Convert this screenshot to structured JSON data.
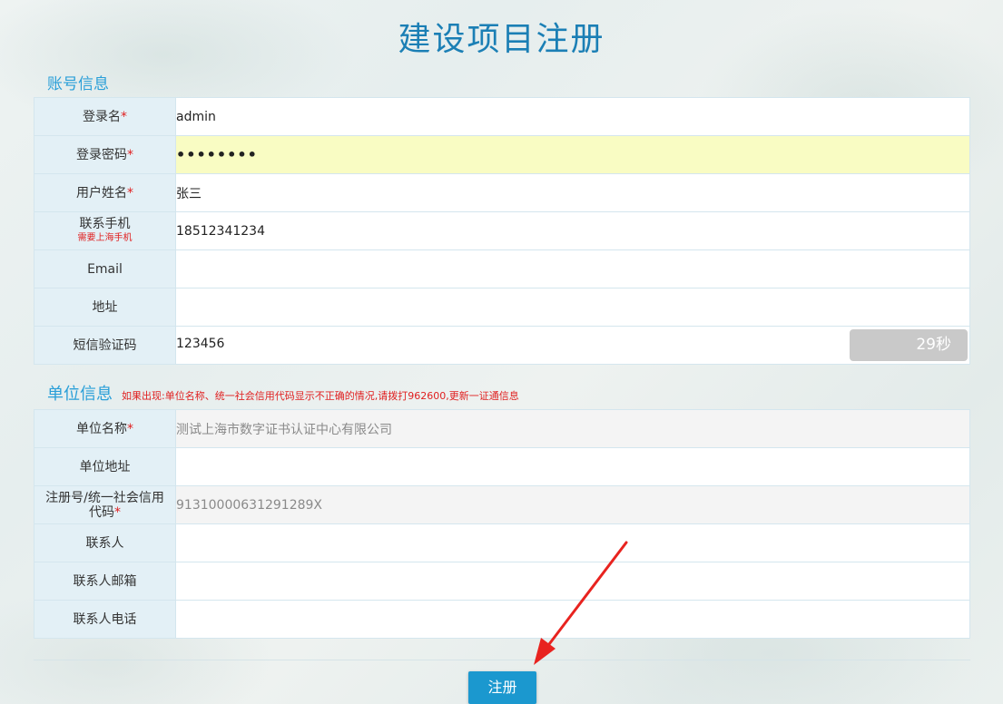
{
  "page": {
    "title": "建设项目注册"
  },
  "account_section": {
    "title": "账号信息",
    "rows": [
      {
        "label": "登录名",
        "required": true,
        "value": "admin"
      },
      {
        "label": "登录密码",
        "required": true,
        "value": "••••••••"
      },
      {
        "label": "用户姓名",
        "required": true,
        "value": "张三"
      },
      {
        "label": "联系手机",
        "sub_note": "需要上海手机",
        "value": "18512341234"
      },
      {
        "label": "Email",
        "value": ""
      },
      {
        "label": "地址",
        "value": ""
      },
      {
        "label": "短信验证码",
        "value": "123456",
        "button": "29秒"
      }
    ]
  },
  "unit_section": {
    "title": "单位信息",
    "note": "如果出现:单位名称、统一社会信用代码显示不正确的情况,请拨打962600,更新一证通信息",
    "rows": [
      {
        "label": "单位名称",
        "required": true,
        "value": "测试上海市数字证书认证中心有限公司"
      },
      {
        "label": "单位地址",
        "value": ""
      },
      {
        "label": "注册号/统一社会信用",
        "label_line2": "代码",
        "required": true,
        "value": "91310000631291289X"
      },
      {
        "label": "联系人",
        "value": ""
      },
      {
        "label": "联系人邮箱",
        "value": ""
      },
      {
        "label": "联系人电话",
        "value": ""
      }
    ]
  },
  "required_mark": "*",
  "submit": {
    "label": "注册"
  },
  "colors": {
    "accent": "#1b98cf",
    "required": "#e02020",
    "arrow": "#e8231f",
    "password_bg": "#f9fcc3"
  }
}
